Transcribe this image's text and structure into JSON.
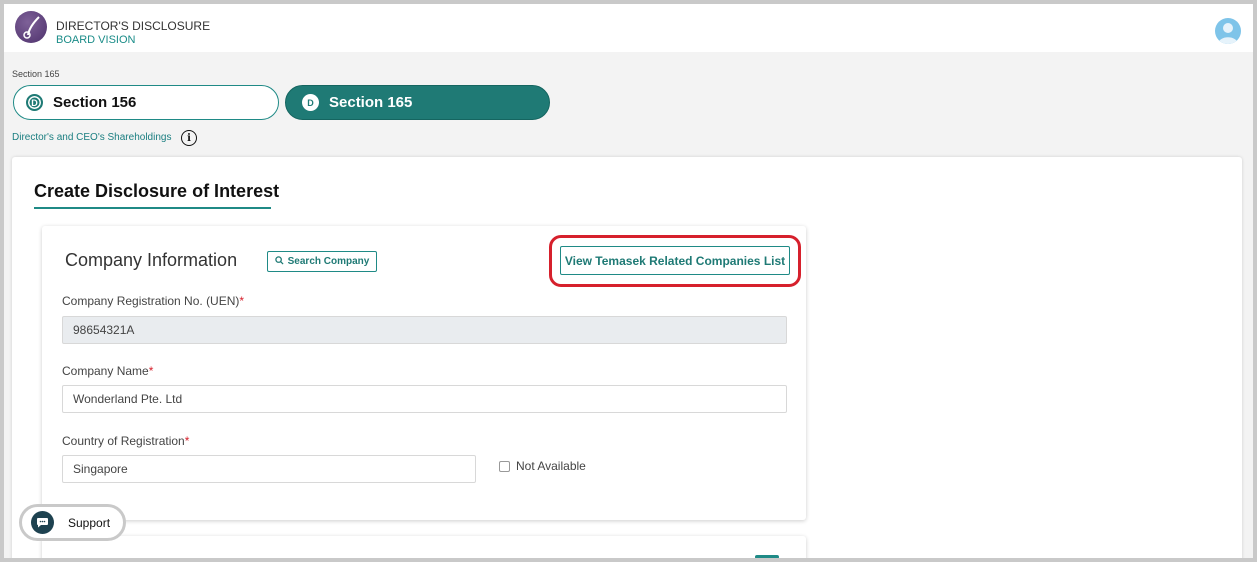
{
  "header": {
    "app_title": "DIRECTOR'S DISCLOSURE",
    "app_subtitle": "BOARD VISION",
    "avatar_icon": "user-avatar-icon"
  },
  "breadcrumb": {
    "current": "Section 165",
    "sub": "Director's and CEO's Shareholdings",
    "info_glyph": "i"
  },
  "section_tabs": [
    {
      "label": "Section 156",
      "icon": "D",
      "selected": false
    },
    {
      "label": "Section 165",
      "icon": "D",
      "selected": true
    }
  ],
  "page": {
    "title": "Create Disclosure of Interest"
  },
  "company_info": {
    "title": "Company Information",
    "search_button": "Search Company",
    "temasek_button": "View Temasek Related Companies List",
    "uen_label": "Company Registration No. (UEN)",
    "uen_value": "98654321A",
    "name_label": "Company Name",
    "name_value": "Wonderland Pte. Ltd",
    "country_label": "Country of Registration",
    "country_value": "Singapore",
    "not_available_label": "Not Available",
    "required_mark": "*"
  },
  "support": {
    "label": "Support"
  },
  "colors": {
    "accent": "#1f8a86",
    "accent_dark": "#1f7a75",
    "highlight": "#d6202c"
  }
}
